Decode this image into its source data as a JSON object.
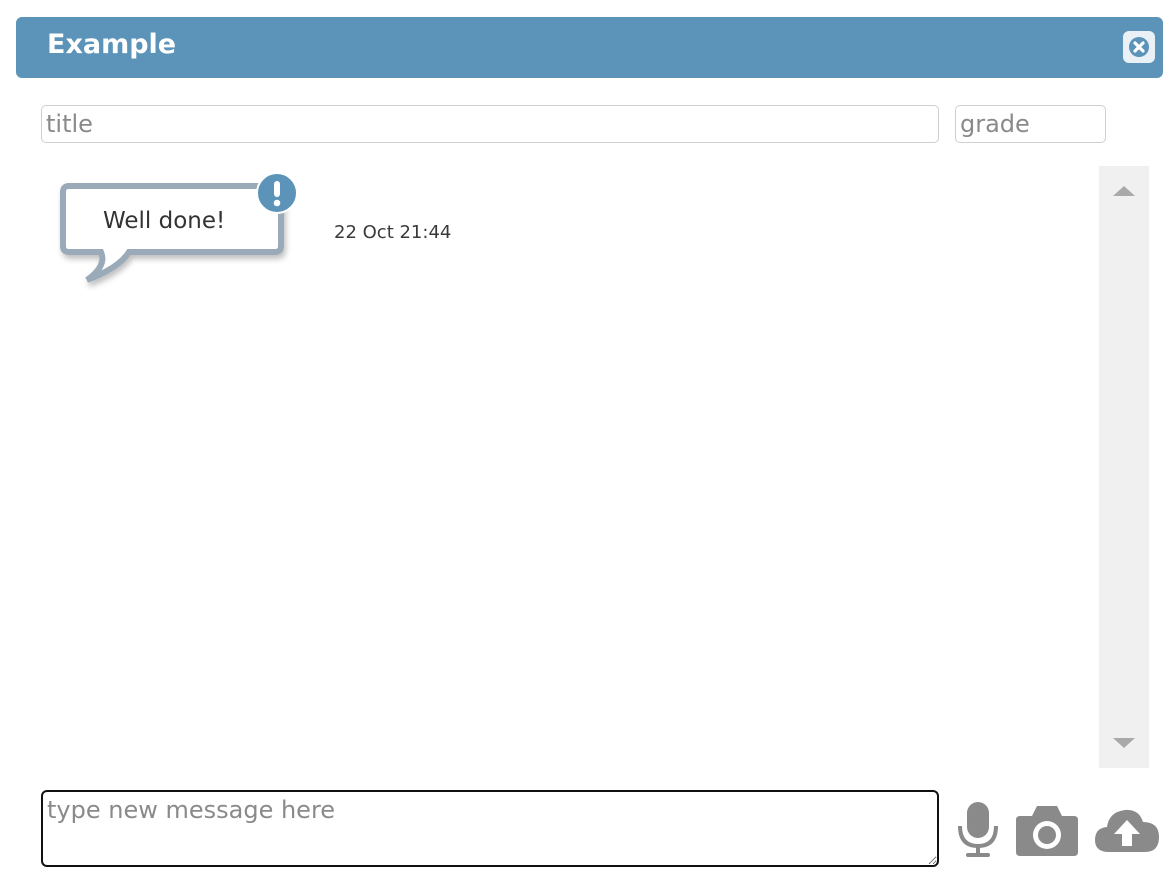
{
  "window": {
    "title": "Example",
    "close_icon": "close-icon"
  },
  "form": {
    "title_placeholder": "title",
    "grade_placeholder": "grade"
  },
  "messages": [
    {
      "text": "Well done!",
      "timestamp": "22 Oct 21:44",
      "badge_icon": "exclamation-icon"
    }
  ],
  "composer": {
    "placeholder": "type new message here",
    "tools": [
      "microphone-icon",
      "camera-icon",
      "cloud-upload-icon"
    ]
  },
  "colors": {
    "titlebar": "#5b93b9",
    "scrollbar_track": "#f0f0f0",
    "icons": "#8a8a8a"
  }
}
